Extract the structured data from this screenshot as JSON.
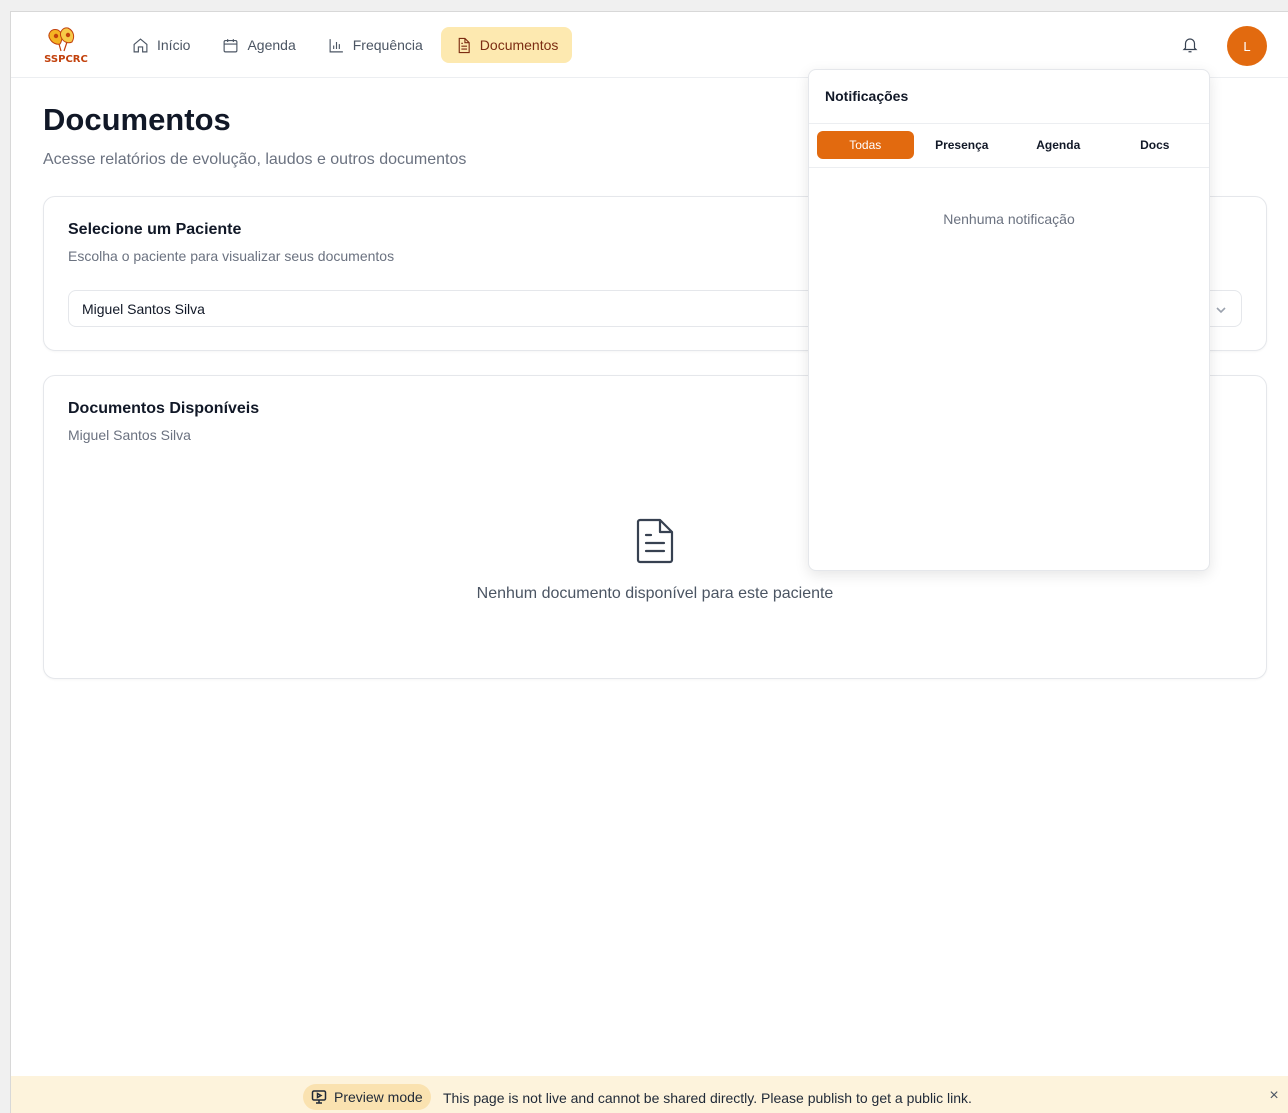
{
  "header": {
    "logo_text": "SSPCRC",
    "nav": [
      {
        "label": "Início",
        "icon": "home-icon"
      },
      {
        "label": "Agenda",
        "icon": "calendar-icon"
      },
      {
        "label": "Frequência",
        "icon": "bar-chart-icon"
      },
      {
        "label": "Documentos",
        "icon": "file-text-icon",
        "active": true
      }
    ],
    "avatar_initial": "L"
  },
  "main": {
    "title": "Documentos",
    "subtitle": "Acesse relatórios de evolução, laudos e outros documentos",
    "patient_card": {
      "title": "Selecione um Paciente",
      "subtitle": "Escolha o paciente para visualizar seus documentos",
      "selected_patient": "Miguel Santos Silva"
    },
    "documents_card": {
      "title": "Documentos Disponíveis",
      "subtitle": "Miguel Santos Silva",
      "empty_message": "Nenhum documento disponível para este paciente"
    }
  },
  "notifications": {
    "title": "Notificações",
    "tabs": [
      "Todas",
      "Presença",
      "Agenda",
      "Docs"
    ],
    "active_tab": "Todas",
    "empty_message": "Nenhuma notificação"
  },
  "preview_bar": {
    "badge": "Preview mode",
    "message": "This page is not live and cannot be shared directly. Please publish to get a public link."
  },
  "colors": {
    "accent": "#e26a0f",
    "active_nav_bg": "#fde9b0",
    "preview_bg": "#fdf3dc"
  }
}
